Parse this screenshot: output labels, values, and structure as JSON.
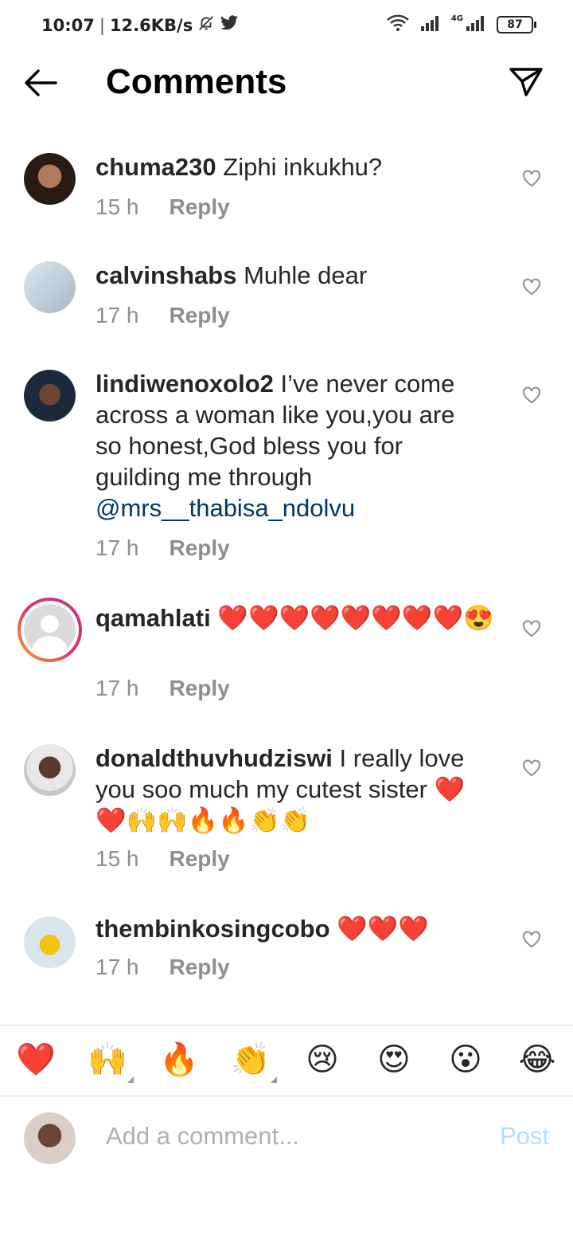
{
  "status_bar": {
    "time": "10:07",
    "speed": "12.6KB/s",
    "network": "4G",
    "battery": "87"
  },
  "header": {
    "title": "Comments"
  },
  "comments": [
    {
      "username": "chuma230",
      "text": "Ziphi inkukhu?",
      "time": "15 h",
      "reply": "Reply"
    },
    {
      "username": "calvinshabs",
      "text": "Muhle dear",
      "time": "17 h",
      "reply": "Reply"
    },
    {
      "username": "lindiwenoxolo2",
      "text": "I’ve never come across a woman like you,you are so honest,God bless you for guilding me through",
      "mention": "@mrs__thabisa_ndolvu",
      "time": "17 h",
      "reply": "Reply"
    },
    {
      "username": "qamahlati",
      "text": "❤️❤️❤️❤️❤️❤️❤️❤️😍",
      "time": "17 h",
      "reply": "Reply"
    },
    {
      "username": "donaldthuvhudziswi",
      "text": "I really love you soo much my cutest sister ❤️❤️🙌🙌🔥🔥👏👏",
      "time": "15 h",
      "reply": "Reply"
    },
    {
      "username": "thembinkosingcobo",
      "text": "❤️❤️❤️",
      "time": "17 h",
      "reply": "Reply"
    }
  ],
  "emoji_bar": [
    "❤️",
    "🙌",
    "🔥",
    "👏",
    "😢",
    "😍",
    "😮",
    "😂"
  ],
  "composer": {
    "placeholder": "Add a comment...",
    "post_label": "Post"
  },
  "icons": {
    "back": "arrow-left-icon",
    "send": "paper-plane-icon",
    "like": "heart-outline-icon"
  }
}
